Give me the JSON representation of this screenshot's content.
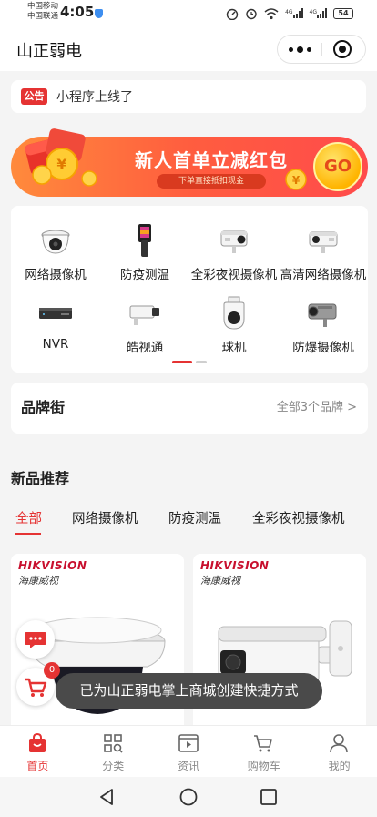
{
  "status_bar": {
    "carrier_1": "中国移动",
    "carrier_2": "中国联通",
    "time": "4:05",
    "net_1": "4G",
    "net_2": "4G",
    "battery": "54"
  },
  "header": {
    "title": "山正弱电",
    "more_icon": "more-dots-icon",
    "close_icon": "target-close-icon"
  },
  "notice": {
    "badge": "公告",
    "text": "小程序上线了"
  },
  "banner": {
    "title": "新人首单立减红包",
    "subtitle": "下单直接抵扣现金",
    "go_label": "GO"
  },
  "categories": [
    {
      "label": "网络摄像机",
      "icon": "dome-camera-icon"
    },
    {
      "label": "防疫测温",
      "icon": "thermal-gun-icon"
    },
    {
      "label": "全彩夜视摄像机",
      "icon": "bullet-camera-icon"
    },
    {
      "label": "高清网络摄像机",
      "icon": "bullet-camera-icon"
    },
    {
      "label": "NVR",
      "icon": "nvr-recorder-icon"
    },
    {
      "label": "皓视通",
      "icon": "box-camera-icon"
    },
    {
      "label": "球机",
      "icon": "speed-dome-icon"
    },
    {
      "label": "防爆摄像机",
      "icon": "explosion-proof-camera-icon"
    }
  ],
  "pager": {
    "active_index": 0,
    "count": 2
  },
  "brand_street": {
    "title": "品牌街",
    "more": "全部3个品牌 >"
  },
  "new_products": {
    "title": "新品推荐",
    "tabs": [
      "全部",
      "网络摄像机",
      "防疫测温",
      "全彩夜视摄像机"
    ],
    "active_tab": 0,
    "cards": [
      {
        "brand_en": "HIKVISION",
        "brand_cn": "海康威视",
        "image": "fisheye-camera"
      },
      {
        "brand_en": "HIKVISION",
        "brand_cn": "海康威视",
        "image": "bullet-camera"
      }
    ]
  },
  "floating": {
    "chat_icon": "chat-bubble-icon",
    "cart_icon": "cart-icon",
    "cart_count": "0"
  },
  "toast": "已为山正弱电掌上商城创建快捷方式",
  "tabbar": {
    "items": [
      {
        "label": "首页",
        "icon": "shopping-bag-icon"
      },
      {
        "label": "分类",
        "icon": "category-grid-icon"
      },
      {
        "label": "资讯",
        "icon": "video-news-icon"
      },
      {
        "label": "购物车",
        "icon": "cart-icon"
      },
      {
        "label": "我的",
        "icon": "user-icon"
      }
    ],
    "active": 0
  },
  "colors": {
    "accent": "#e53333",
    "banner_start": "#ff8a3c",
    "banner_end": "#ff4b4b",
    "go_button": "#ffb400",
    "hikvision_red": "#c8102e"
  }
}
